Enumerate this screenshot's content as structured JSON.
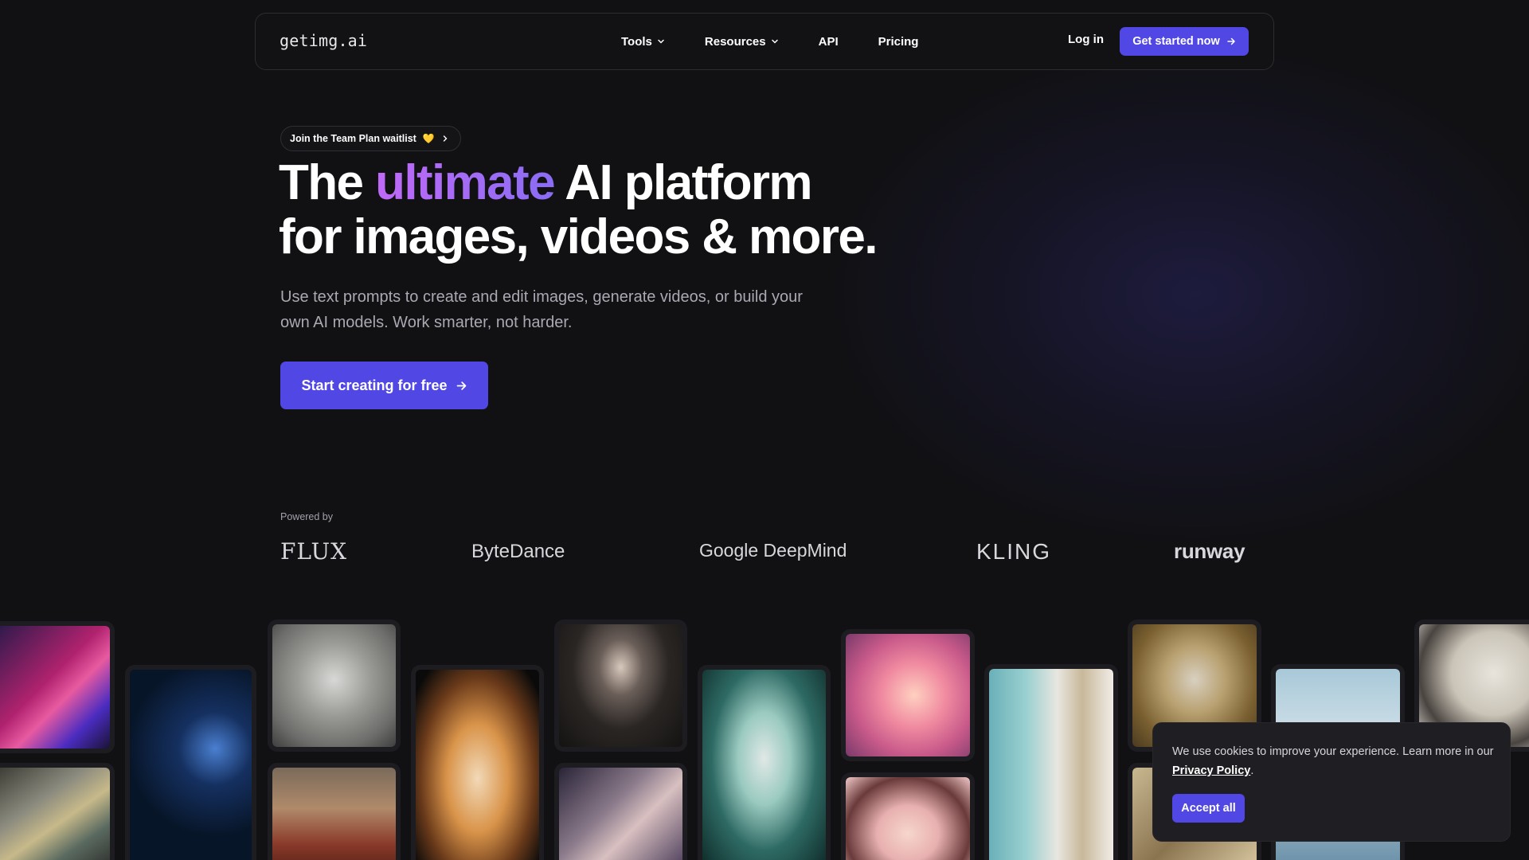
{
  "nav": {
    "logo": "getimg.ai",
    "links": [
      {
        "label": "Tools",
        "dropdown": true
      },
      {
        "label": "Resources",
        "dropdown": true
      },
      {
        "label": "API",
        "dropdown": false
      },
      {
        "label": "Pricing",
        "dropdown": false
      }
    ],
    "login": "Log in",
    "cta": "Get started now"
  },
  "hero": {
    "pill": "Join the Team Plan waitlist",
    "pill_emoji": "💛",
    "headline_pre": "The ",
    "headline_accent": "ultimate",
    "headline_post": " AI platform",
    "headline_line2": "for images, videos & more.",
    "subtitle": "Use text prompts to create and edit images, generate videos, or build your own AI models. Work smarter, not harder.",
    "cta": "Start creating for free"
  },
  "powered": {
    "label": "Powered by",
    "brands": [
      "FLUX",
      "ByteDance",
      "Google DeepMind",
      "KLING",
      "runway"
    ]
  },
  "cookie": {
    "text": "We use cookies to improve your experience. Learn more in our ",
    "link": "Privacy Policy",
    "period": ".",
    "accept": "Accept all"
  },
  "colors": {
    "background": "#111114",
    "accent": "#5147e4",
    "headline_gradient": [
      "#c06af6",
      "#8a6cf5"
    ]
  },
  "gallery": [
    {
      "name": "glitch-portrait-image"
    },
    {
      "name": "polygon-dog-image"
    },
    {
      "name": "robot-skull-image"
    },
    {
      "name": "snow-leopard-image"
    },
    {
      "name": "monk-portrait-image"
    },
    {
      "name": "corgi-image"
    },
    {
      "name": "woman-black-dress-image"
    },
    {
      "name": "fairy-woman-image"
    },
    {
      "name": "butterfly-woman-image"
    },
    {
      "name": "anime-pink-girl-image"
    },
    {
      "name": "anime-bob-girl-image"
    },
    {
      "name": "kitchen-interior-image"
    },
    {
      "name": "golden-statue-image"
    },
    {
      "name": "golden-detail-image"
    },
    {
      "name": "blue-abstract-image"
    },
    {
      "name": "ink-painting-woman-image"
    }
  ]
}
